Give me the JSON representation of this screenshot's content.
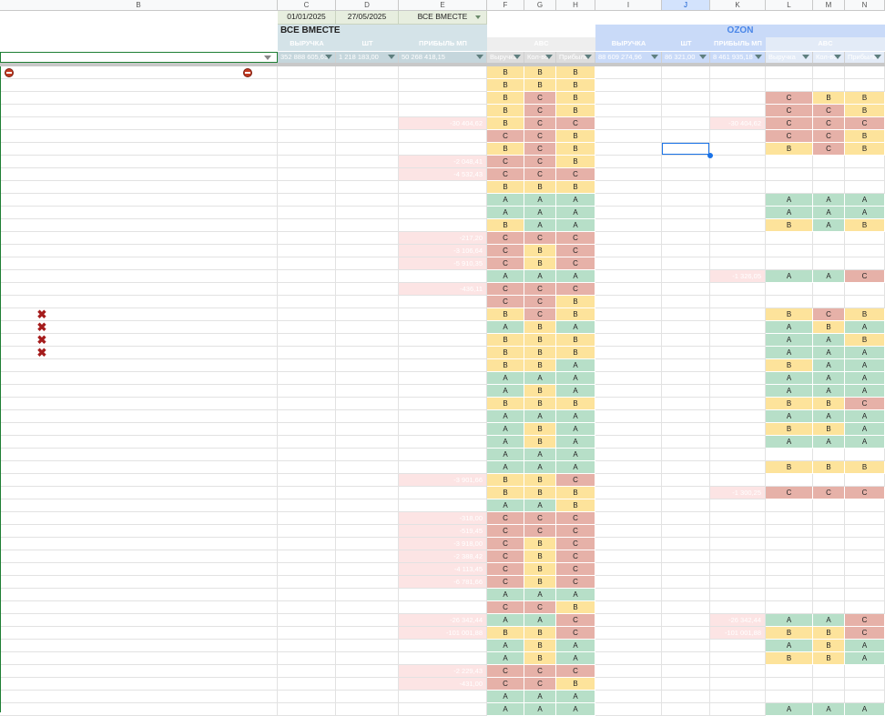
{
  "columns": [
    "B",
    "C",
    "D",
    "E",
    "F",
    "G",
    "H",
    "I",
    "J",
    "K",
    "L",
    "M",
    "N"
  ],
  "selected_column": "J",
  "header": {
    "date_from": "01/01/2025",
    "date_to": "27/05/2025",
    "group_select": "ВСЕ ВМЕСТЕ",
    "section_all": "ВСЕ ВМЕСТЕ",
    "section_ozon": "OZON",
    "sub_all": [
      "ВЫРУЧКА",
      "ШТ",
      "ПРИБЫЛЬ МП",
      "ABC"
    ],
    "sub_ozon": [
      "ВЫРУЧКА",
      "ШТ",
      "ПРИБЫЛЬ МП",
      "ABC"
    ]
  },
  "filter_row": {
    "C": "352 888 605,63",
    "D": "1 218 183,00",
    "E": "50 268 418,15",
    "F": "Выручка",
    "G": "Кол-во",
    "H": "Прибыль",
    "I": "88 609 274,96",
    "J": "86 321,00",
    "K": "8 461 935,18",
    "L": "Выручка",
    "M": "Кол-во",
    "N": "Прибыль"
  },
  "rows": [
    {
      "all": "BBB",
      "oz": "",
      "e": "",
      "k": ""
    },
    {
      "all": "BBB",
      "oz": "",
      "e": "",
      "k": ""
    },
    {
      "all": "BCB",
      "oz": "CBB",
      "e": "",
      "k": ""
    },
    {
      "all": "BCB",
      "oz": "CCB",
      "e": "",
      "k": ""
    },
    {
      "all": "BCC",
      "oz": "CCC",
      "e": "-30 404,62",
      "k": "-30 404,62"
    },
    {
      "all": "CCB",
      "oz": "CCB",
      "e": "",
      "k": ""
    },
    {
      "all": "BCB",
      "oz": "BCB",
      "e": "",
      "k": ""
    },
    {
      "all": "CCB",
      "oz": "",
      "e": "-2 048,41",
      "k": ""
    },
    {
      "all": "CCC",
      "oz": "",
      "e": "-4 532,43",
      "k": ""
    },
    {
      "all": "BBB",
      "oz": "",
      "e": "",
      "k": ""
    },
    {
      "all": "AAA",
      "oz": "AAA",
      "e": "",
      "k": ""
    },
    {
      "all": "AAA",
      "oz": "AAA",
      "e": "",
      "k": ""
    },
    {
      "all": "BAA",
      "oz": "BAB",
      "e": "",
      "k": ""
    },
    {
      "all": "CCC",
      "oz": "",
      "e": "-217,20",
      "k": ""
    },
    {
      "all": "CBC",
      "oz": "",
      "e": "-3 106,64",
      "k": ""
    },
    {
      "all": "CBC",
      "oz": "",
      "e": "-5 910,35",
      "k": ""
    },
    {
      "all": "AAA",
      "oz": "AAC",
      "e": "",
      "k": "-1 326,05"
    },
    {
      "all": "CCC",
      "oz": "",
      "e": "-436,11",
      "k": ""
    },
    {
      "all": "CCB",
      "oz": "",
      "e": "",
      "k": ""
    },
    {
      "all": "BCB",
      "oz": "BCB",
      "e": "",
      "k": ""
    },
    {
      "all": "ABA",
      "oz": "ABA",
      "e": "",
      "k": ""
    },
    {
      "all": "BBB",
      "oz": "AAB",
      "e": "",
      "k": ""
    },
    {
      "all": "BBB",
      "oz": "AAA",
      "e": "",
      "k": ""
    },
    {
      "all": "BBA",
      "oz": "BAA",
      "e": "",
      "k": ""
    },
    {
      "all": "AAA",
      "oz": "AAA",
      "e": "",
      "k": ""
    },
    {
      "all": "ABA",
      "oz": "AAA",
      "e": "",
      "k": ""
    },
    {
      "all": "BBB",
      "oz": "BBC",
      "e": "",
      "k": ""
    },
    {
      "all": "AAA",
      "oz": "AAA",
      "e": "",
      "k": ""
    },
    {
      "all": "ABA",
      "oz": "BBA",
      "e": "",
      "k": ""
    },
    {
      "all": "ABA",
      "oz": "AAA",
      "e": "",
      "k": ""
    },
    {
      "all": "AAA",
      "oz": "",
      "e": "",
      "k": ""
    },
    {
      "all": "AAA",
      "oz": "BBB",
      "e": "",
      "k": ""
    },
    {
      "all": "BBC",
      "oz": "",
      "e": "-3 901,66",
      "k": ""
    },
    {
      "all": "BBB",
      "oz": "CCC",
      "e": "",
      "k": "-1 300,25"
    },
    {
      "all": "AAB",
      "oz": "",
      "e": "",
      "k": ""
    },
    {
      "all": "CCC",
      "oz": "",
      "e": "-318,00",
      "k": ""
    },
    {
      "all": "CCC",
      "oz": "",
      "e": "-519,45",
      "k": ""
    },
    {
      "all": "CBC",
      "oz": "",
      "e": "-3 918,00",
      "k": ""
    },
    {
      "all": "CBC",
      "oz": "",
      "e": "-2 388,42",
      "k": ""
    },
    {
      "all": "CBC",
      "oz": "",
      "e": "-4 113,45",
      "k": ""
    },
    {
      "all": "CBC",
      "oz": "",
      "e": "-6 781,66",
      "k": ""
    },
    {
      "all": "AAA",
      "oz": "",
      "e": "",
      "k": ""
    },
    {
      "all": "CCB",
      "oz": "",
      "e": "",
      "k": ""
    },
    {
      "all": "AAC",
      "oz": "AAC",
      "e": "-26 342,44",
      "k": "-26 342,44"
    },
    {
      "all": "BBC",
      "oz": "BBC",
      "e": "-101 001,88",
      "k": "-101 001,88"
    },
    {
      "all": "ABA",
      "oz": "ABA",
      "e": "",
      "k": ""
    },
    {
      "all": "ABA",
      "oz": "BBA",
      "e": "",
      "k": ""
    },
    {
      "all": "CCC",
      "oz": "",
      "e": "-2 229,43",
      "k": ""
    },
    {
      "all": "CCB",
      "oz": "",
      "e": "-431,00",
      "k": ""
    },
    {
      "all": "AAA",
      "oz": "",
      "e": "",
      "k": ""
    },
    {
      "all": "AAA",
      "oz": "AAA",
      "e": "",
      "k": ""
    },
    {
      "all": "ABA",
      "oz": "BBB",
      "e": "",
      "k": ""
    }
  ],
  "markers": {
    "minus_rows": [
      0
    ],
    "x_rows": [
      19,
      20,
      21,
      22
    ]
  },
  "icons": {
    "minus": "remove-circle-icon",
    "x": "close-x-icon",
    "filter": "filter-dropdown-icon"
  },
  "colors": {
    "A": "#b7dfc8",
    "B": "#fde39b",
    "C": "#e6b1a8",
    "header_all": "#d4e3e8",
    "header_ozon": "#c9daf8",
    "ozon_text": "#4a86e8",
    "selection": "#1a73e8"
  }
}
